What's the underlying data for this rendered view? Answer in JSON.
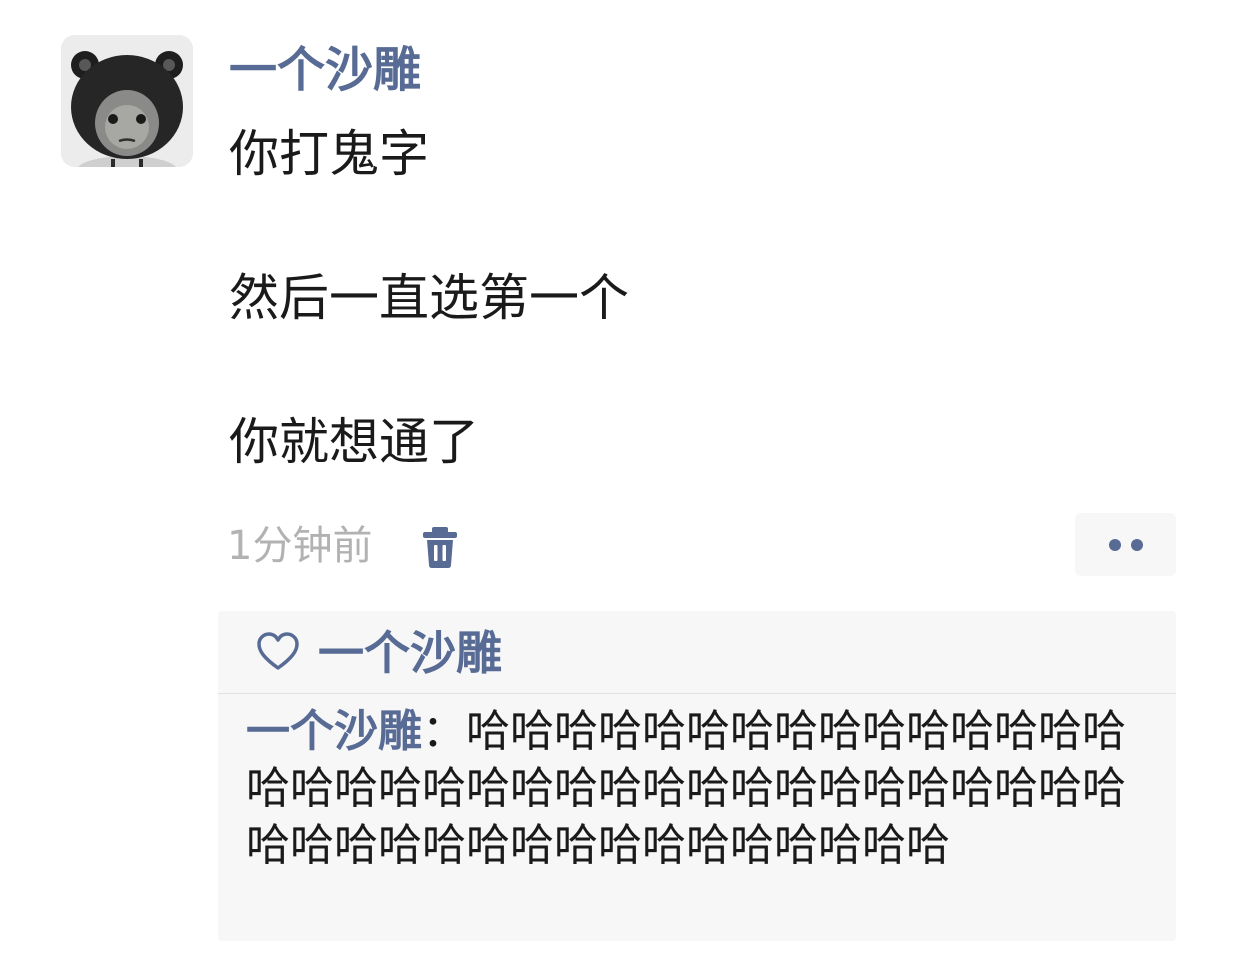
{
  "post": {
    "author": "一个沙雕",
    "lines": [
      "你打鬼字",
      "然后一直选第一个",
      "你就想通了"
    ],
    "timestamp": "1分钟前"
  },
  "icons": {
    "avatar": "cartoon-face-avatar",
    "delete": "trash-icon",
    "more": "two-dots-icon",
    "like": "heart-outline-icon"
  },
  "likes": {
    "names": "一个沙雕"
  },
  "comments": [
    {
      "author": "一个沙雕",
      "separator": "：",
      "text": "哈哈哈哈哈哈哈哈哈哈哈哈哈哈哈哈哈哈哈哈哈哈哈哈哈哈哈哈哈哈哈哈哈哈哈哈哈哈哈哈哈哈哈哈哈哈哈哈哈哈哈"
    }
  ],
  "colors": {
    "link_blue": "#576b95",
    "text": "#1a1a1a",
    "muted": "#b2b2b2",
    "panel_bg": "#f7f7f7"
  }
}
